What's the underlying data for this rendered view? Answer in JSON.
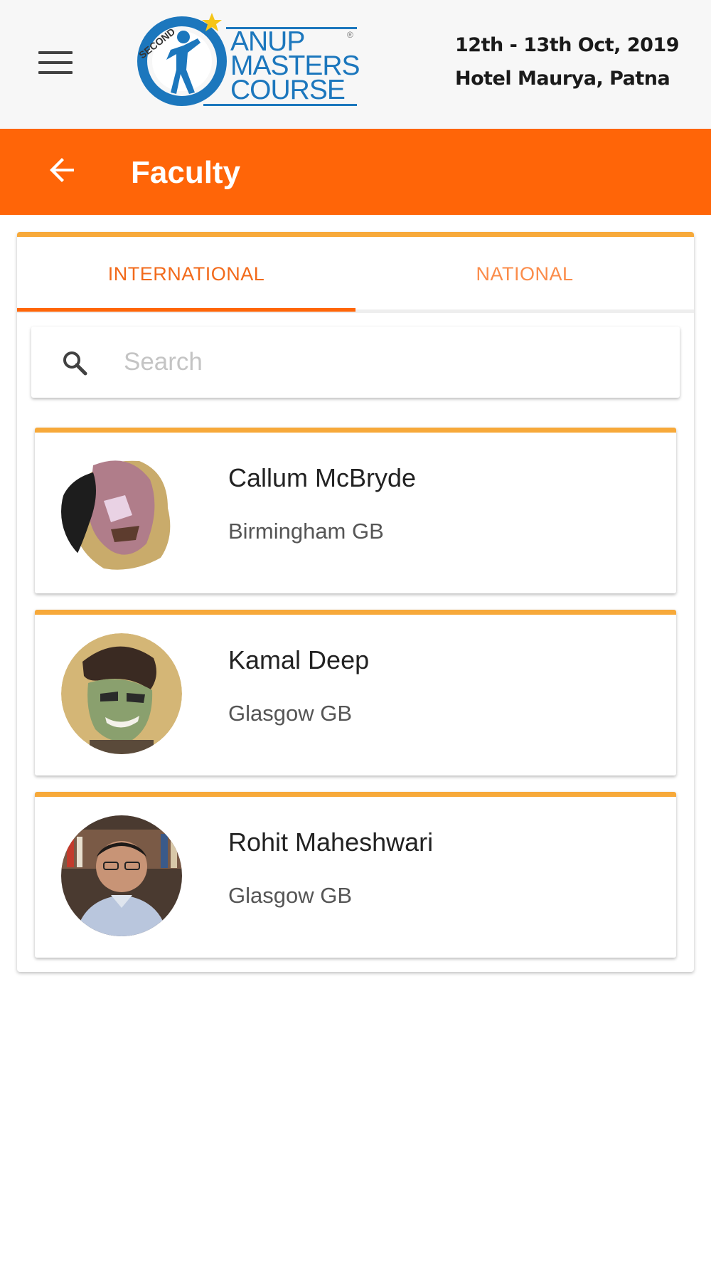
{
  "header": {
    "menu_icon": "hamburger-menu-icon",
    "logo": {
      "prefix": "SECOND",
      "line1": "ANUP",
      "line2": "MASTERS",
      "line3": "COURSE",
      "registered": "®"
    },
    "event_date": "12th - 13th Oct, 2019",
    "event_venue": "Hotel Maurya, Patna"
  },
  "toolbar": {
    "back_icon": "arrow-left-icon",
    "title": "Faculty"
  },
  "tabs": [
    {
      "label": "INTERNATIONAL",
      "active": true
    },
    {
      "label": "NATIONAL",
      "active": false
    }
  ],
  "search": {
    "icon": "search-icon",
    "placeholder": "Search",
    "value": ""
  },
  "faculty": [
    {
      "name": "Callum McBryde",
      "location": "Birmingham GB"
    },
    {
      "name": "Kamal Deep",
      "location": "Glasgow GB"
    },
    {
      "name": "Rohit Maheshwari",
      "location": "Glasgow GB"
    }
  ],
  "colors": {
    "primary": "#ff6508",
    "accent": "#f7a93a",
    "header_bg": "#f7f7f7",
    "logo_blue": "#1c77bd"
  }
}
